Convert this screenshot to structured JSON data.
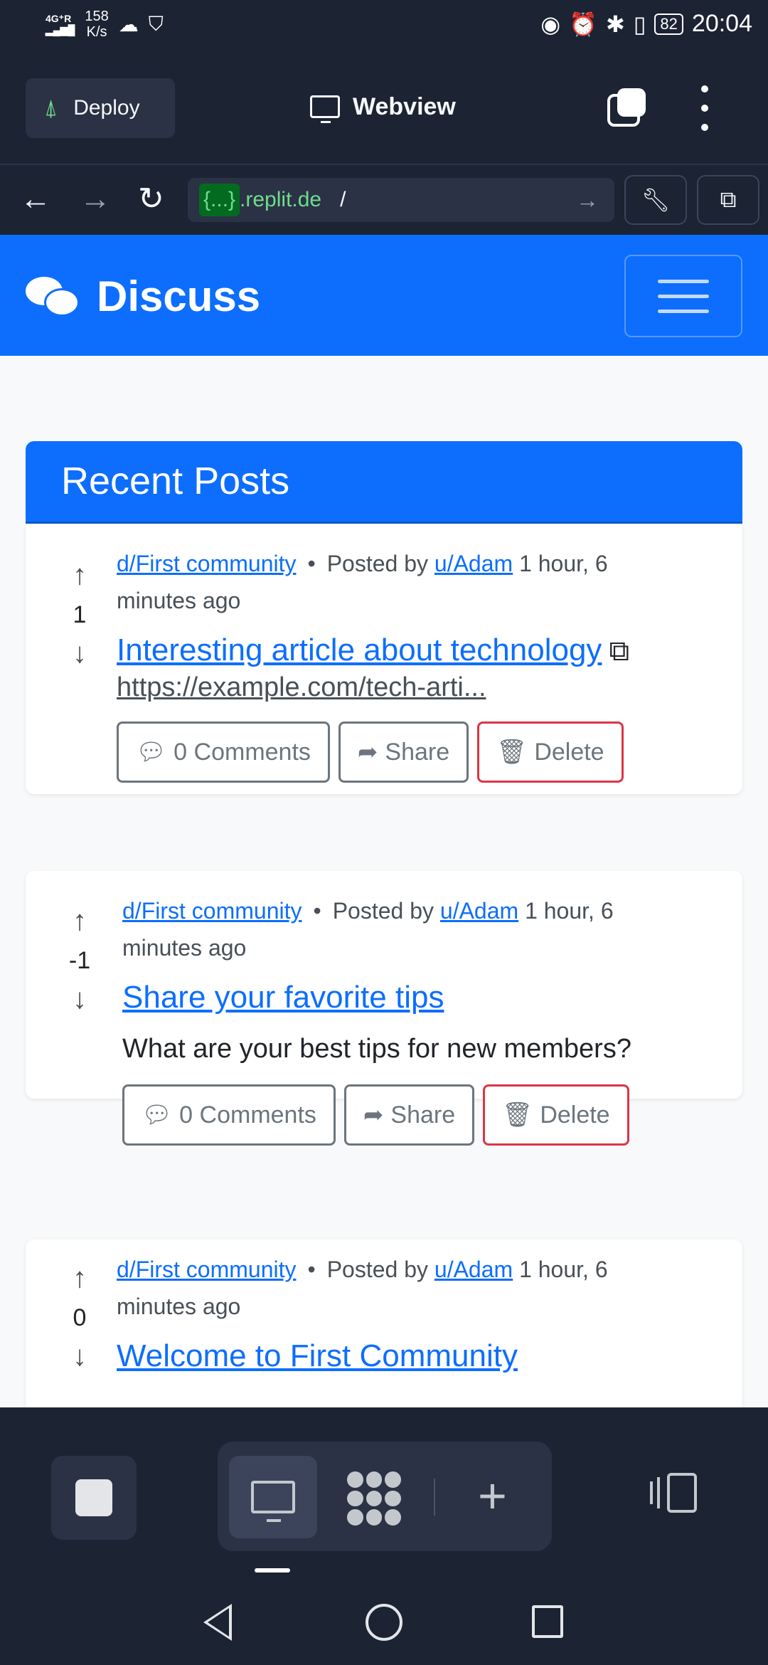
{
  "status_bar": {
    "network": "4G⁺R",
    "speed_value": "158",
    "speed_unit": "K/s",
    "battery": "82",
    "time": "20:04"
  },
  "app_header": {
    "deploy_label": "Deploy",
    "webview_title": "Webview"
  },
  "url_bar": {
    "curly": "{...}",
    "domain": ".replit.de",
    "path": "/"
  },
  "site": {
    "brand": "Discuss",
    "section_title": "Recent Posts"
  },
  "posts": [
    {
      "score": "1",
      "community": "d/First community",
      "posted_by_prefix": "Posted by",
      "user": "u/Adam",
      "time": "1 hour, 6 minutes ago",
      "title": "Interesting article about technology",
      "url": "https://example.com/tech-arti...",
      "comments_label": "0 Comments",
      "share_label": "Share",
      "delete_label": "Delete"
    },
    {
      "score": "-1",
      "community": "d/First community",
      "posted_by_prefix": "Posted by",
      "user": "u/Adam",
      "time": "1 hour, 6 minutes ago",
      "title": "Share your favorite tips",
      "body": "What are your best tips for new members?",
      "comments_label": "0 Comments",
      "share_label": "Share",
      "delete_label": "Delete"
    },
    {
      "score": "0",
      "community": "d/First community",
      "posted_by_prefix": "Posted by",
      "user": "u/Adam",
      "time": "1 hour, 6 minutes ago",
      "title": "Welcome to First Community"
    }
  ],
  "colors": {
    "primary": "#0d6efd",
    "danger": "#dc3545",
    "replit_bg": "#1c2333",
    "replit_surface": "#2b3245",
    "replit_green": "#6fdc8c"
  },
  "icons": {
    "upvote": "arrow-up-icon",
    "downvote": "arrow-down-icon",
    "comment": "comment-icon",
    "share": "share-icon",
    "delete": "trash-icon",
    "external": "external-link-icon"
  }
}
